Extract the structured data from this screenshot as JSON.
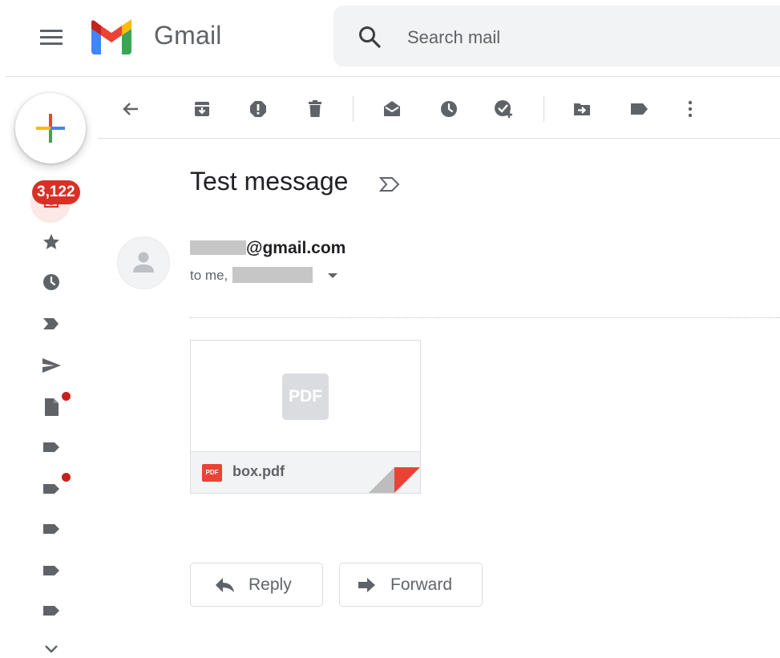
{
  "header": {
    "brand": "Gmail",
    "search": {
      "placeholder": "Search mail",
      "value": ""
    }
  },
  "rail": {
    "inbox_count": "3,122",
    "items": [
      {
        "name": "inbox",
        "icon": "inbox-icon"
      },
      {
        "name": "starred",
        "icon": "star-icon"
      },
      {
        "name": "snoozed",
        "icon": "clock-icon"
      },
      {
        "name": "important",
        "icon": "label-important-icon"
      },
      {
        "name": "sent",
        "icon": "send-icon"
      },
      {
        "name": "drafts",
        "icon": "draft-icon"
      },
      {
        "name": "label",
        "icon": "label-icon"
      },
      {
        "name": "label",
        "icon": "label-icon"
      },
      {
        "name": "label",
        "icon": "label-icon"
      },
      {
        "name": "label",
        "icon": "label-icon"
      },
      {
        "name": "label",
        "icon": "label-icon"
      },
      {
        "name": "more",
        "icon": "chevron-down-icon"
      }
    ]
  },
  "toolbar": {
    "icons": [
      "back-icon",
      "archive-icon",
      "report-spam-icon",
      "delete-icon",
      "mark-unread-icon",
      "snooze-icon",
      "add-task-icon",
      "move-to-icon",
      "label-icon",
      "more-vert-icon"
    ]
  },
  "message": {
    "subject": "Test message",
    "sender_domain": "@gmail.com",
    "recipients_prefix": "to me,",
    "attachment": {
      "filename": "box.pdf",
      "type_label": "PDF"
    }
  },
  "actions": {
    "reply": "Reply",
    "forward": "Forward"
  },
  "colors": {
    "badge": "#d93025",
    "icon_dark": "#5f6368",
    "search_bg": "#f1f3f4",
    "pdf_red": "#ea4335"
  }
}
